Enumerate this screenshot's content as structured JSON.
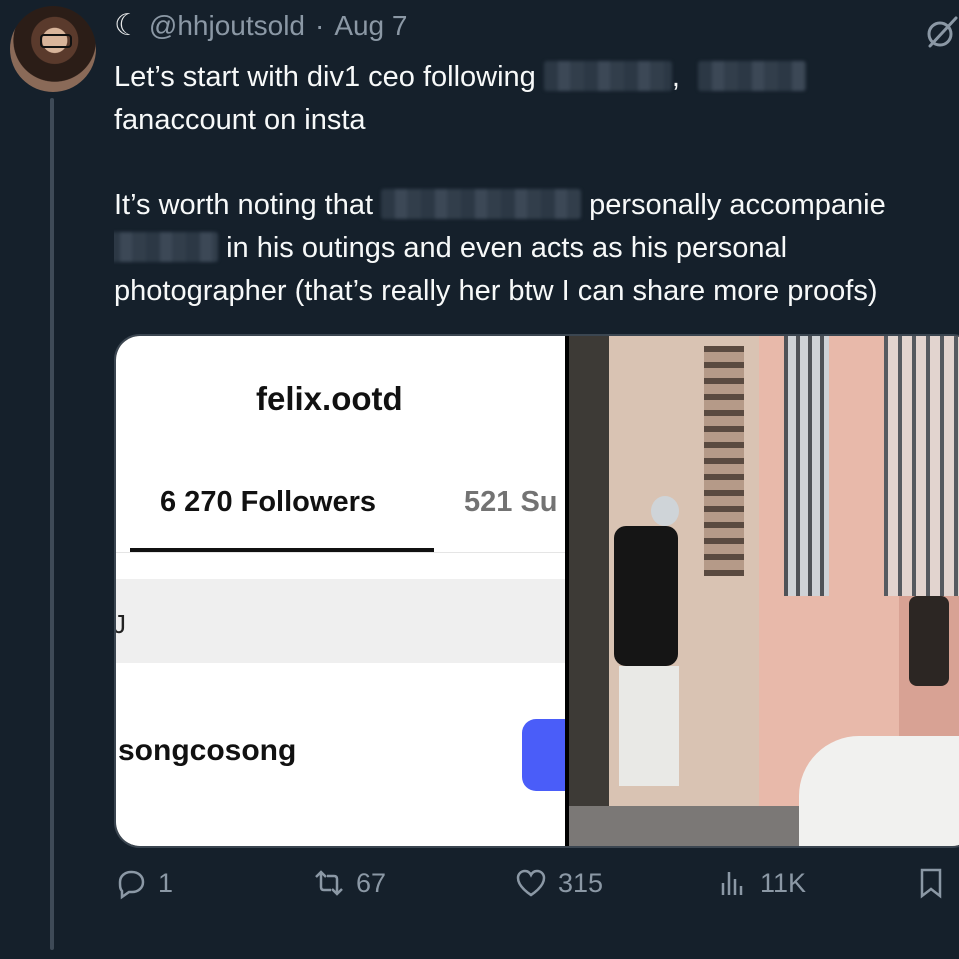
{
  "header": {
    "moon_glyph": "☾",
    "handle": "@hhjoutsold",
    "separator": "·",
    "date": "Aug 7"
  },
  "tweet": {
    "line1": "Let’s start with div1 ceo following",
    "line1_comma": ",",
    "line2": "fanaccount on insta",
    "line3": "It’s worth noting that",
    "line3_tail": "personally accompanie",
    "line4_tail": "in his outings and even acts as his personal",
    "line5": "photographer (that’s really her btw I can share more proofs)"
  },
  "media": {
    "ig_profile_name": "felix.ootd",
    "ig_followers_tab": "6 270 Followers",
    "ig_following_tab": "521 Su",
    "ig_search_fragment": "J",
    "ig_list_username": "songcosong"
  },
  "actions": {
    "replies": "1",
    "reposts": "67",
    "likes": "315",
    "views": "11K"
  },
  "colors": {
    "background": "#15202b",
    "text": "#f7f9f9",
    "muted": "#8b98a5",
    "ig_button": "#4a5df9"
  }
}
